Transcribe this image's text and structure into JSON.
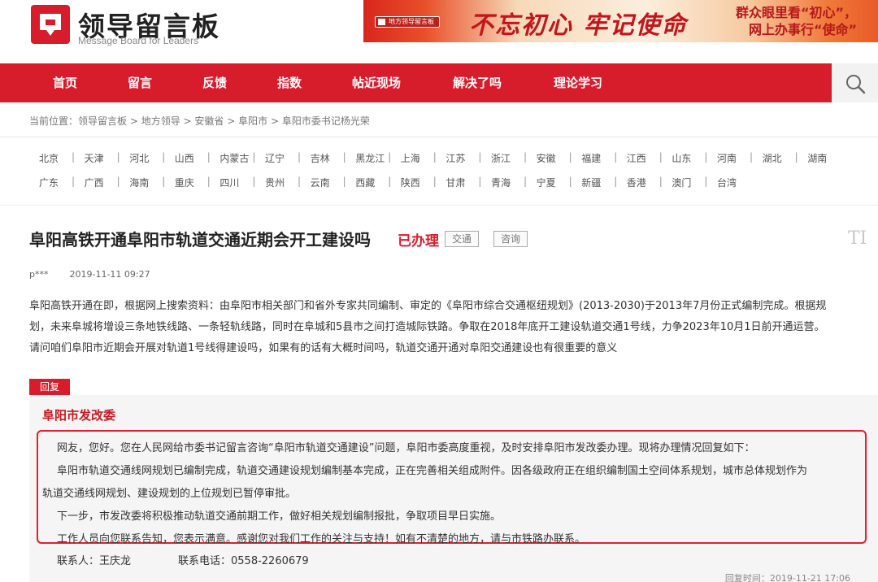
{
  "logo": {
    "title": "领导留言板",
    "subtitle": "Message Board for Leaders",
    "mark_color": "#d71c2c"
  },
  "banner": {
    "logo_text": "地方领导留言板",
    "slogan": "不忘初心 牢记使命",
    "right_line1": "群众眼里看“初心”，",
    "right_line2": "网上办事行“使命”"
  },
  "nav": {
    "items": [
      "首页",
      "留言",
      "反馈",
      "指数",
      "帖近现场",
      "解决了吗",
      "理论学习"
    ],
    "search_icon": "search-icon",
    "color": "#d71c2c"
  },
  "breadcrumb": {
    "prefix": "当前位置：",
    "items": [
      "领导留言板",
      "地方领导",
      "安徽省",
      "阜阳市",
      "阜阳市委书记杨光荣"
    ],
    "separator": " > "
  },
  "provinces": {
    "row1": [
      "北京",
      "天津",
      "河北",
      "山西",
      "内蒙古",
      "辽宁",
      "吉林",
      "黑龙江",
      "上海",
      "江苏",
      "浙江",
      "安徽",
      "福建",
      "江西",
      "山东",
      "河南",
      "湖北",
      "湖南"
    ],
    "row2": [
      "广东",
      "广西",
      "海南",
      "重庆",
      "四川",
      "贵州",
      "云南",
      "西藏",
      "陕西",
      "甘肃",
      "青海",
      "宁夏",
      "新疆",
      "香港",
      "澳门",
      "台湾"
    ],
    "separator": "|"
  },
  "post": {
    "title": "阜阳高铁开通阜阳市轨道交通近期会开工建设吗",
    "status": "已办理",
    "tags": [
      "交通",
      "咨询"
    ],
    "font_tool": "TI",
    "author": "p***",
    "date": "2019-11-11 09:27",
    "body": [
      "阜阳高铁开通在即，根据网上搜索资料：由阜阳市相关部门和省外专家共同编制、审定的《阜阳市综合交通枢纽规划》(2013-2030)于2013年7月份正式编制完成。根据规",
      "划，未来阜城将增设三条地铁线路、一条轻轨线路，同时在阜城和5县市之间打造城际铁路。争取在2018年底开工建设轨道交通1号线，力争2023年10月1日前开通运营。",
      "请问咱们阜阳市近期会开展对轨道1号线得建设吗，如果有的话有大概时间吗，轨道交通开通对阜阳交通建设也有很重要的意义"
    ]
  },
  "reply": {
    "tag": "回复",
    "org": "阜阳市发改委",
    "lines": [
      "网友，您好。您在人民网给市委书记留言咨询“阜阳市轨道交通建设”问题，阜阳市委高度重视，及时安排阜阳市发改委办理。现将办理情况回复如下：",
      "阜阳市轨道交通线网规划已编制完成，轨道交通建设规划编制基本完成，正在完善相关组成附件。因各级政府正在组织编制国土空间体系规划，城市总体规划作为",
      "轨道交通线网规划、建设规划的上位规划已暂停审批。",
      "下一步，市发改委将积极推动轨道交通前期工作，做好相关规划编制报批，争取项目早日实施。",
      "工作人员向您联系告知，您表示满意。感谢您对我们工作的关注与支持！如有不清楚的地方，请与市铁路办联系。"
    ],
    "contact_label": "联系人：王庆龙",
    "phone_label": "联系电话：0558-2260679",
    "reply_time": "回复时间：2019-11-21 17:06",
    "frame_color": "#e0202c"
  }
}
